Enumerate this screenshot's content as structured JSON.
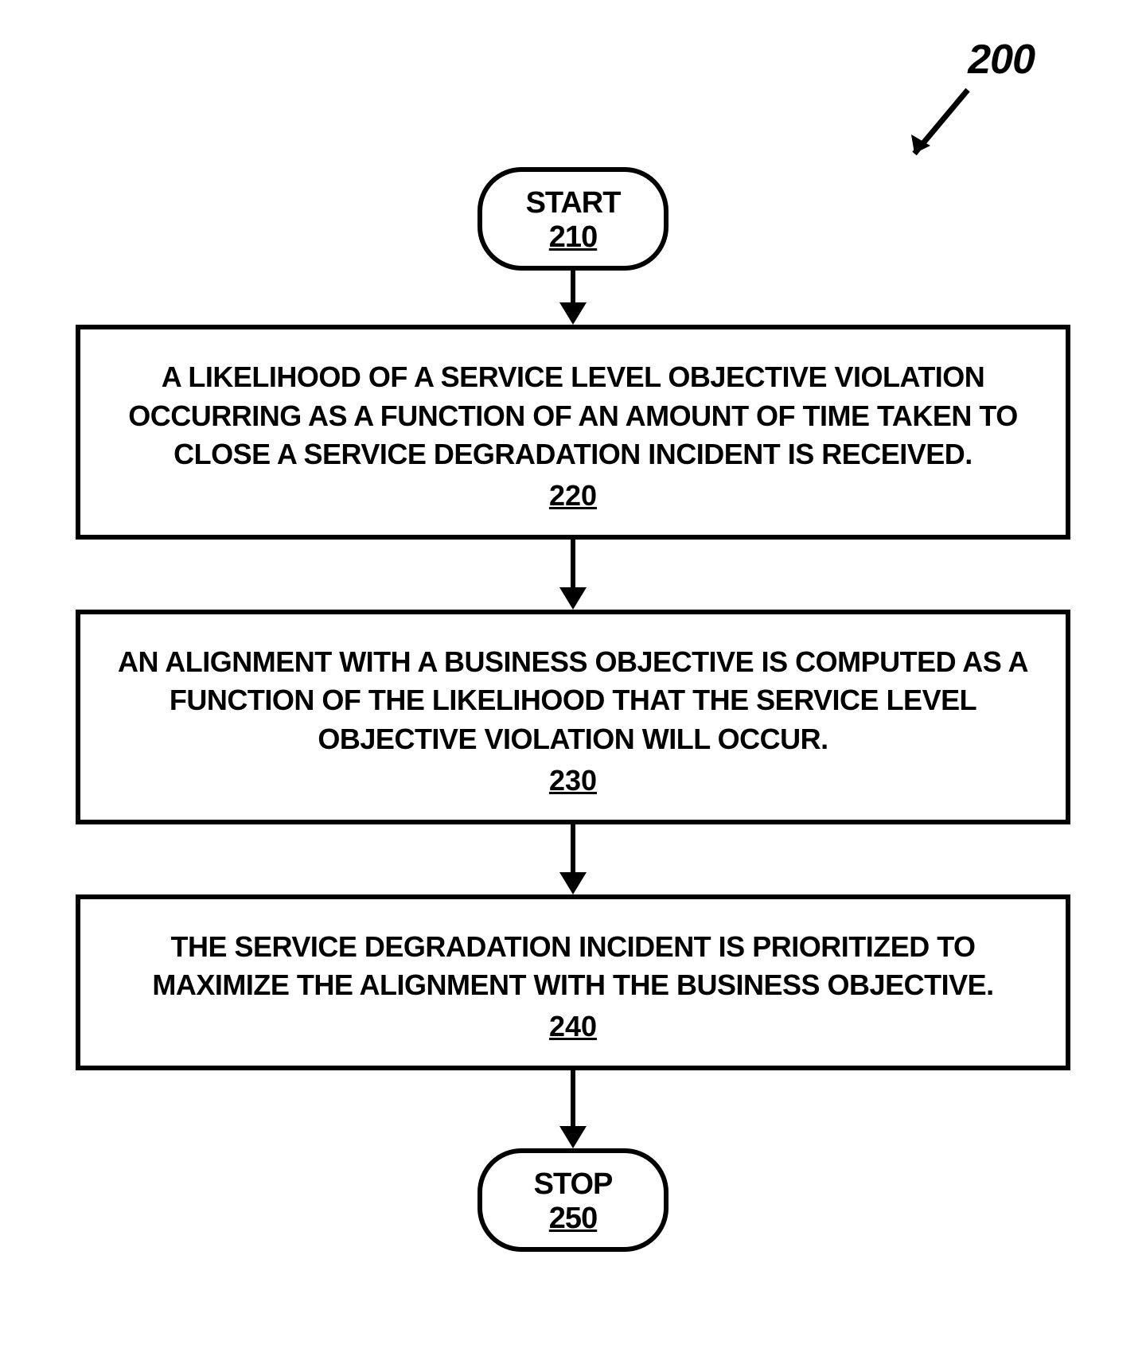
{
  "reference": {
    "label": "200"
  },
  "flowchart": {
    "start": {
      "title": "START",
      "ref": "210"
    },
    "steps": [
      {
        "text": "A LIKELIHOOD OF A SERVICE LEVEL OBJECTIVE VIOLATION OCCURRING AS A FUNCTION OF AN AMOUNT OF TIME TAKEN TO CLOSE A SERVICE DEGRADATION INCIDENT IS RECEIVED.",
        "ref": "220"
      },
      {
        "text": "AN ALIGNMENT WITH A BUSINESS OBJECTIVE IS COMPUTED AS A FUNCTION OF THE LIKELIHOOD THAT THE SERVICE LEVEL OBJECTIVE VIOLATION WILL OCCUR.",
        "ref": "230"
      },
      {
        "text": "THE SERVICE DEGRADATION INCIDENT IS PRIORITIZED TO MAXIMIZE THE ALIGNMENT WITH THE BUSINESS OBJECTIVE.",
        "ref": "240"
      }
    ],
    "stop": {
      "title": "STOP",
      "ref": "250"
    }
  }
}
